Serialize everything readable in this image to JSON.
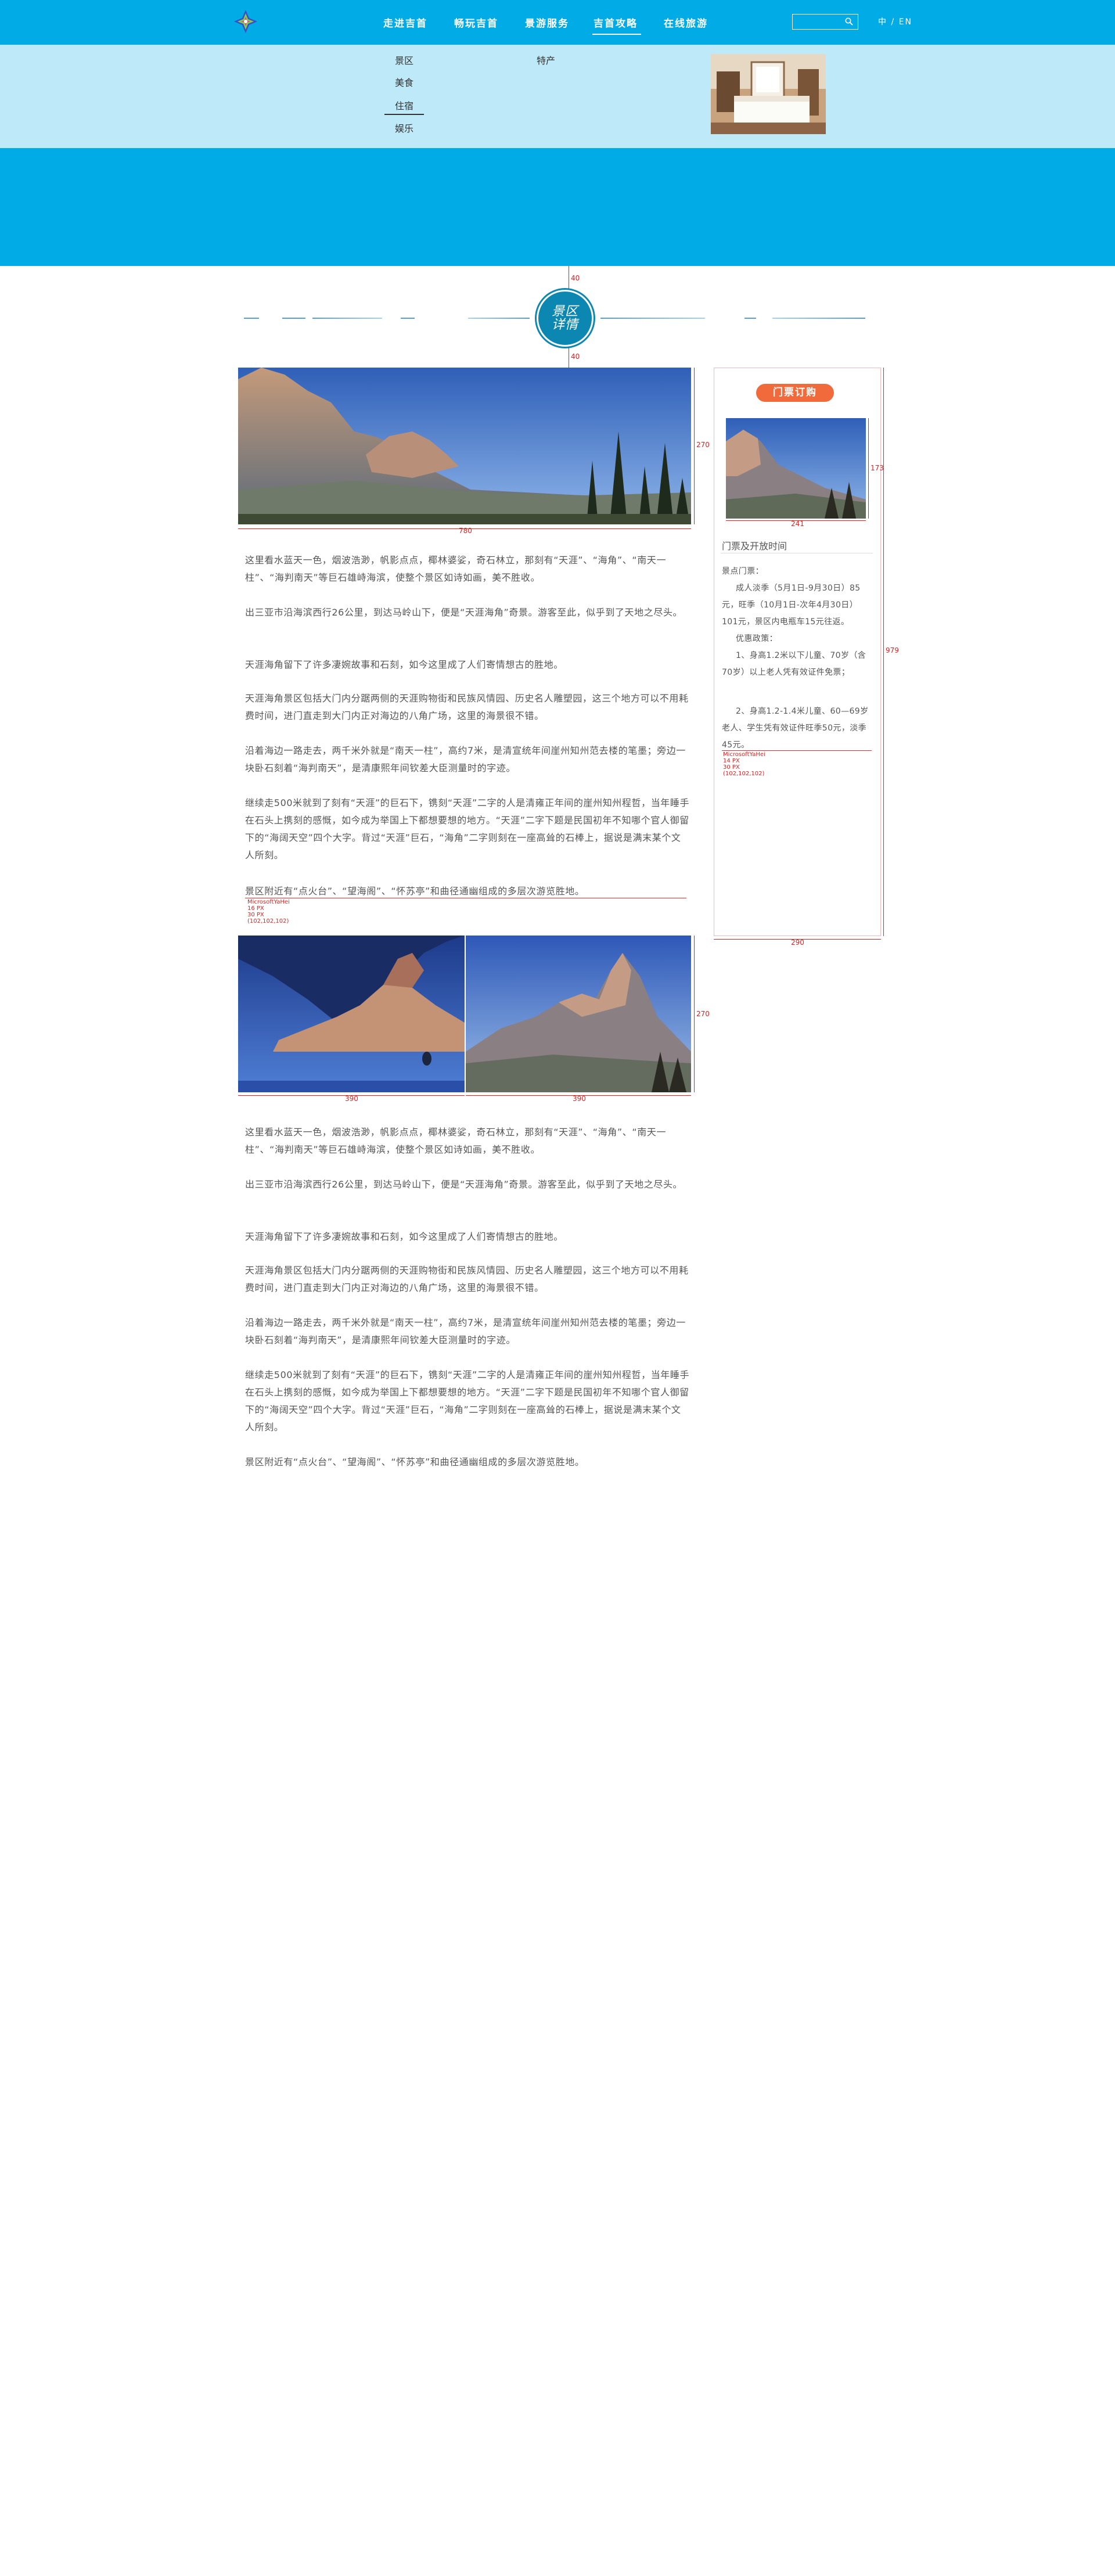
{
  "nav": {
    "items": [
      "走进吉首",
      "畅玩吉首",
      "景游服务",
      "吉首攻略",
      "在线旅游"
    ],
    "active_index": 3,
    "lang": "中 / EN"
  },
  "subnav": {
    "col1": [
      "景区",
      "美食",
      "住宿",
      "娱乐"
    ],
    "col2": [
      "特产"
    ],
    "active": "住宿"
  },
  "section_badge": {
    "line1": "景区",
    "line2": "详情"
  },
  "annotations": {
    "badge_top": "40",
    "badge_bottom": "40",
    "main_photo_h": "270",
    "main_photo_w": "780",
    "side_photo_h": "173",
    "side_photo_w": "241",
    "side_panel_h": "979",
    "side_panel_w": "290",
    "pair_h": "270",
    "pair_left_w": "390",
    "pair_right_w": "390",
    "font_note_main": [
      "MicrosoftYaHei",
      "16 PX",
      "30 PX",
      "(102,102,102)"
    ],
    "font_note_side": [
      "MicrosoftYaHei",
      "14 PX",
      "30 PX",
      "(102,102,102)"
    ]
  },
  "article": {
    "paragraphs": [
      "这里看水蓝天一色，烟波浩渺，帆影点点，椰林婆娑，奇石林立，那刻有“天涯”、“海角”、“南天一柱”、“海判南天”等巨石雄峙海滨，使整个景区如诗如画，美不胜收。",
      "出三亚市沿海滨西行26公里，到达马岭山下，便是“天涯海角”奇景。游客至此，似乎到了天地之尽头。",
      "天涯海角留下了许多凄婉故事和石刻，如今这里成了人们寄情想古的胜地。",
      "天涯海角景区包括大门内分踞两侧的天涯购物街和民族风情园、历史名人雕塑园，这三个地方可以不用耗费时间，进门直走到大门内正对海边的八角广场，这里的海景很不错。",
      "沿着海边一路走去，两千米外就是“南天一柱”，高约7米，是清宣统年间崖州知州范去楼的笔墨；旁边一块卧石刻着“海判南天”，是清康熙年间钦差大臣测量时的字迹。",
      "继续走500米就到了刻有“天涯”的巨石下，镌刻“天涯”二字的人是清雍正年间的崖州知州程哲，当年睡手在石头上携刻的感慨，如今成为举国上下都想要想的地方。“天涯”二字下题是民国初年不知哪个官人御留下的“海阔天空”四个大字。背过“天涯”巨石，“海角”二字则刻在一座高耸的石棒上，据说是满末某个文人所刻。",
      "景区附近有“点火台”、“望海阁”、“怀苏亭”和曲径通幽组成的多层次游览胜地。"
    ]
  },
  "sidebar": {
    "button": "门票订购",
    "title": "门票及开放时间",
    "info": [
      "景点门票：",
      "成人淡季（5月1日-9月30日）85元，旺季（10月1日-次年4月30日）101元，景区内电瓶车15元往返。",
      "优惠政策：",
      "1、身高1.2米以下儿童、70岁（含70岁）以上老人凭有效证件免票；",
      "2、身高1.2-1.4米儿童、60—69岁老人、学生凭有效证件旺季50元，淡季45元。"
    ]
  },
  "colors": {
    "primary": "#00abe6",
    "subnav_bg": "#bde9f8",
    "badge": "#0b87b1",
    "ticket_button": "#f16a3b",
    "annotation": "#e02020"
  }
}
